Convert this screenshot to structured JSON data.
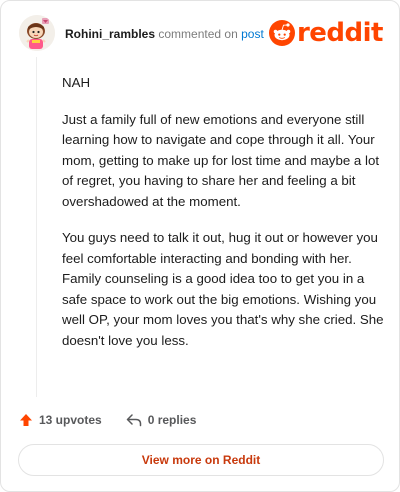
{
  "comment": {
    "username": "Rohini_rambles",
    "commented_on": "commented on",
    "post_link": "post",
    "paragraphs": [
      "NAH",
      "Just a family full of new emotions and everyone still learning how to navigate and cope through it all. Your mom, getting to make up for lost time and maybe a lot of regret, you having to share her and feeling a bit overshadowed at the moment.",
      "You guys need to talk it out, hug it out or however you feel comfortable interacting and bonding with her. Family counseling is a good idea too to get you in a safe space to work out the big emotions. Wishing you well OP, your mom loves you that's why she cried. She doesn't love you less."
    ]
  },
  "brand": {
    "logo_text": "reddit",
    "color": "#ff4500"
  },
  "actions": {
    "upvotes": "13 upvotes",
    "replies": "0 replies"
  },
  "footer": {
    "view_more_label": "View more on Reddit"
  },
  "icons": {
    "avatar": "snoo-avatar-icon",
    "logo": "reddit-logo-icon",
    "upvote": "upvote-arrow-icon",
    "reply": "reply-arrow-icon"
  }
}
